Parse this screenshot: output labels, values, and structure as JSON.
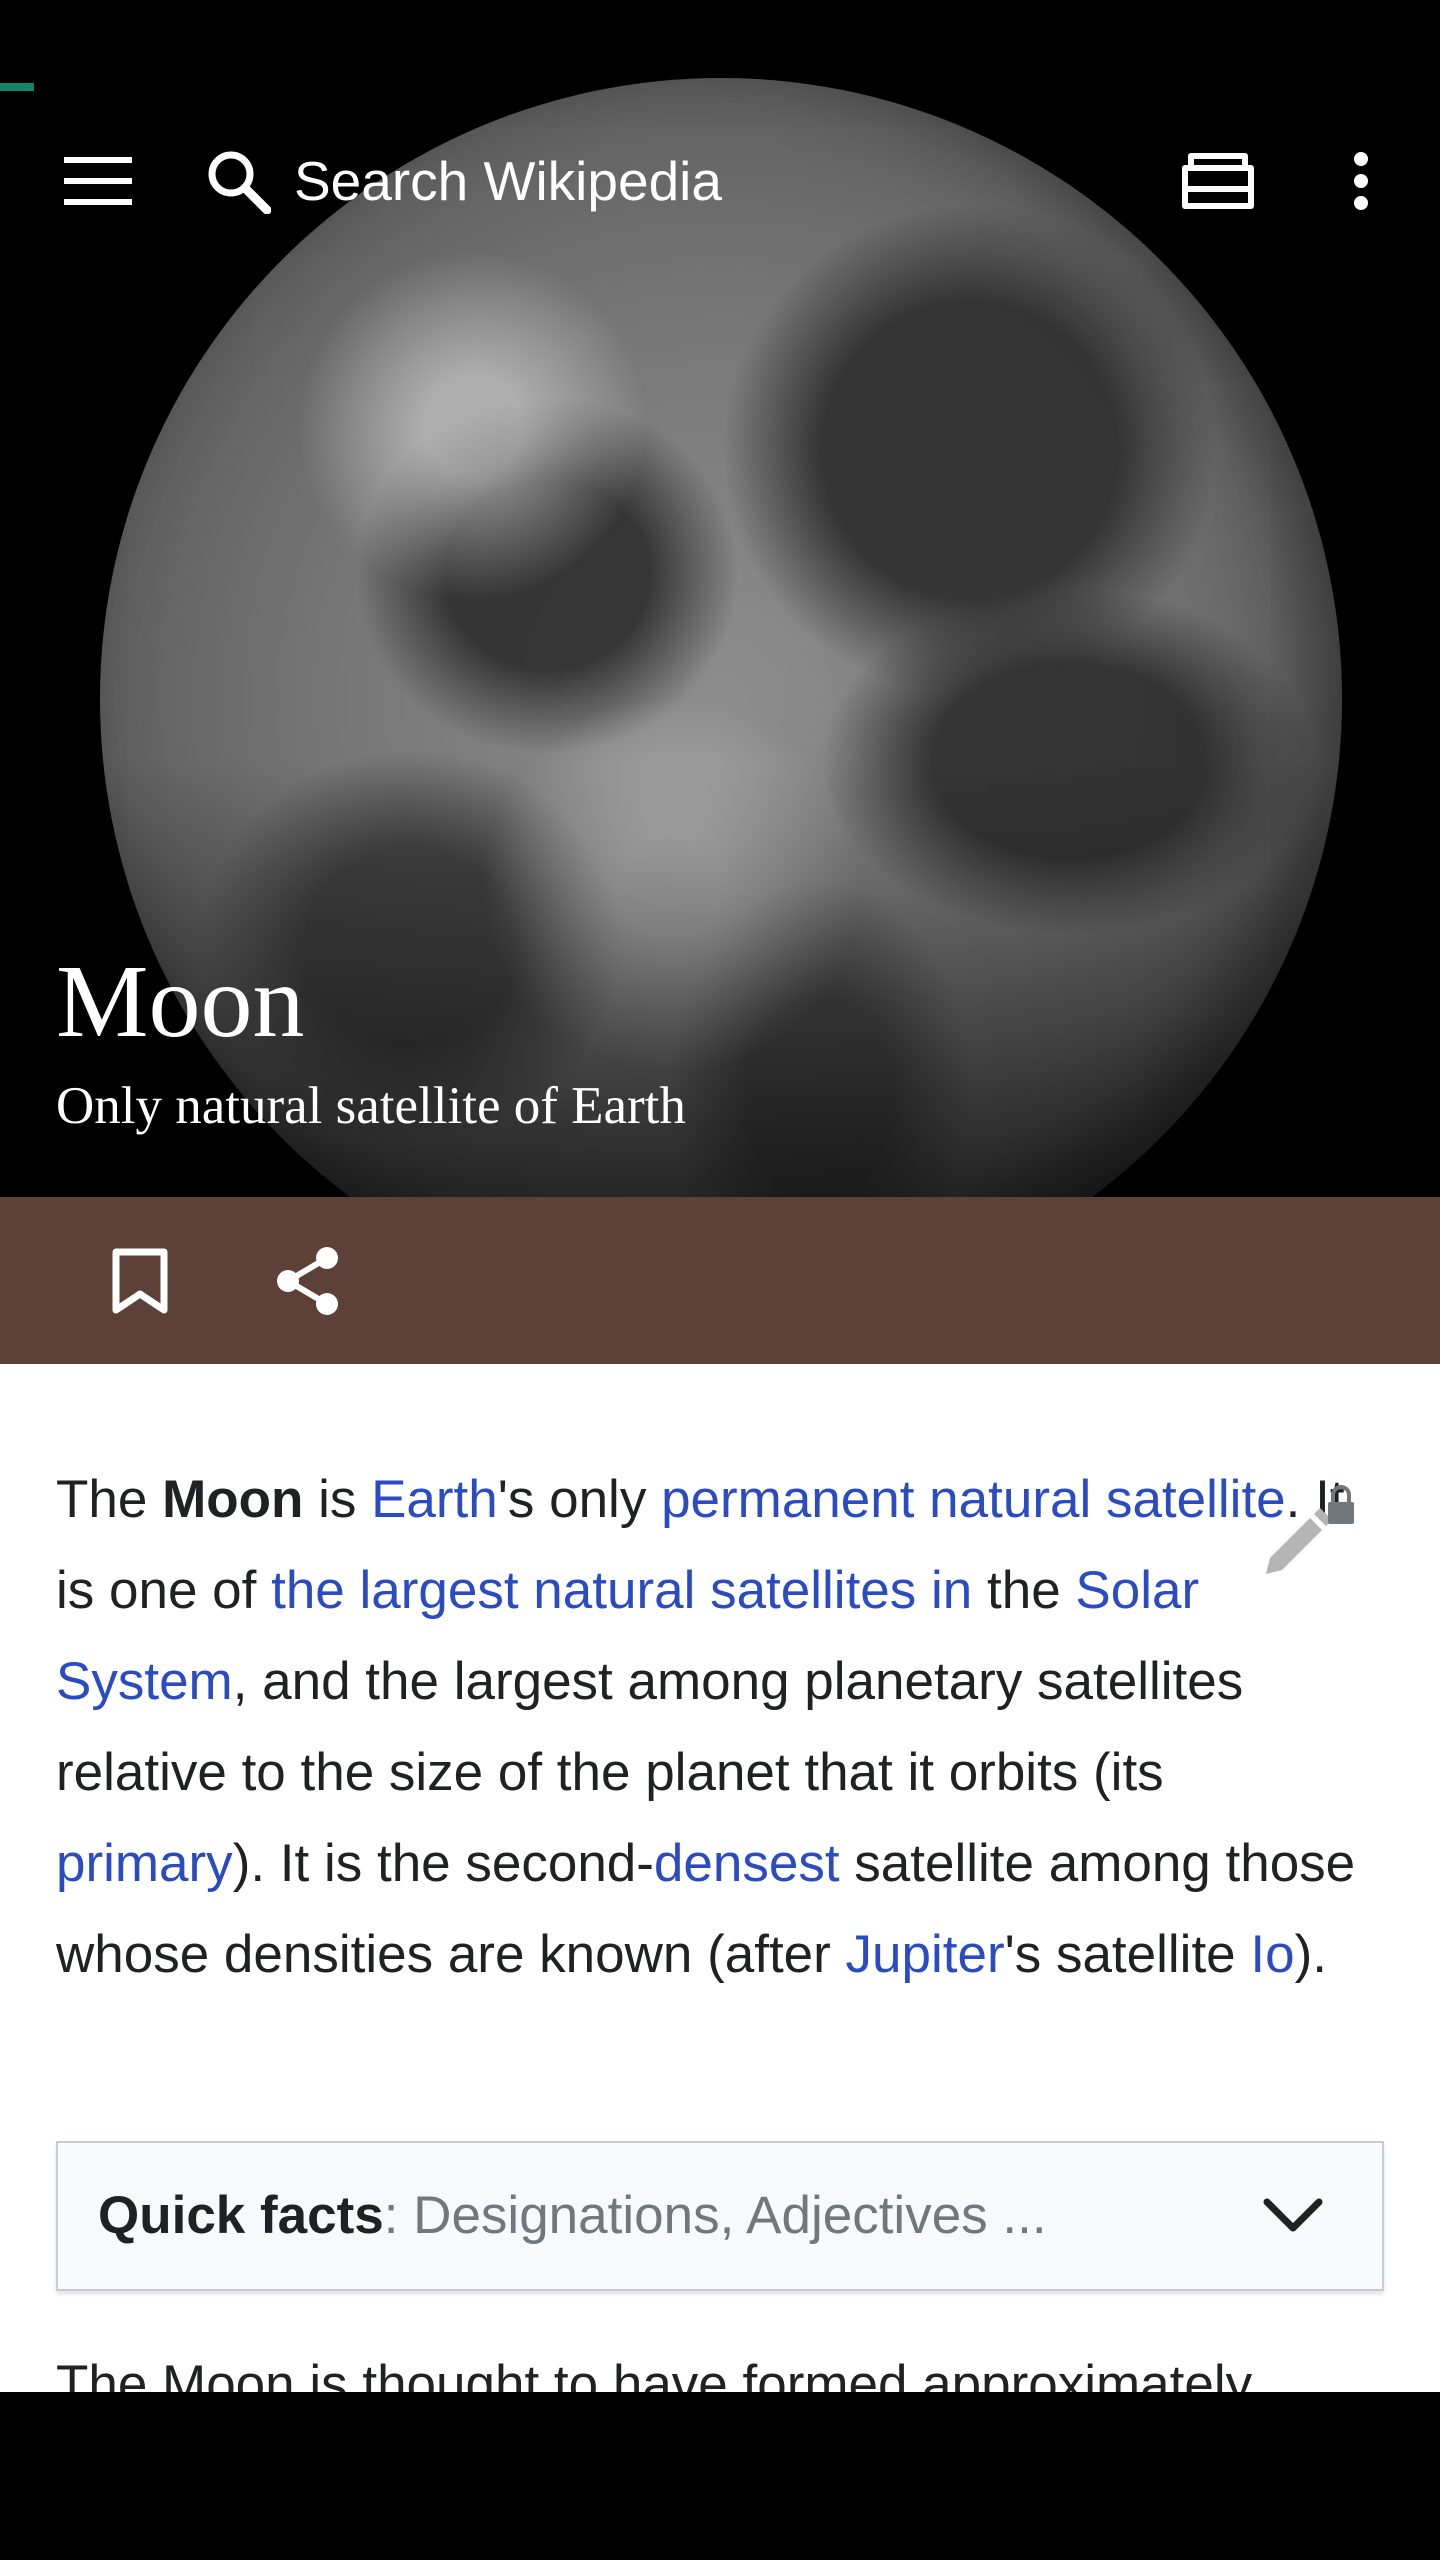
{
  "toolbar": {
    "search_placeholder": "Search Wikipedia",
    "menu_icon": "menu-icon",
    "search_icon": "search-icon",
    "tabs_icon": "tabs-icon",
    "overflow_icon": "overflow-icon"
  },
  "article": {
    "title": "Moon",
    "description": "Only natural satellite of Earth"
  },
  "actions": {
    "bookmark_icon": "bookmark-icon",
    "share_icon": "share-icon"
  },
  "lead": {
    "t1": "The ",
    "bold": "Moon",
    "t2": " is ",
    "link_earth": "Earth",
    "t3": "'s only ",
    "link_permanent": "permanent natural satellite",
    "t4": ". It is one of ",
    "link_largest": "the largest natural satellites in",
    "t5": " the ",
    "link_solar": "Solar System",
    "t6": ", and the largest among planetary satellites relative to the size of the planet that it orbits (its ",
    "link_primary": "primary",
    "t7": "). It is the second-",
    "link_densest": "densest",
    "t8": " satellite among those whose densities are known (after ",
    "link_jupiter": "Jupiter",
    "t9": "'s satellite ",
    "link_io": "Io",
    "t10": ")."
  },
  "quick_facts": {
    "label": "Quick facts",
    "summary": ": Designations, Adjectives ..."
  },
  "next_paragraph": "The Moon is thought to have formed approximately",
  "colors": {
    "action_bar": "#5d4037",
    "link": "#2a4bc2",
    "accent": "#14866d"
  }
}
